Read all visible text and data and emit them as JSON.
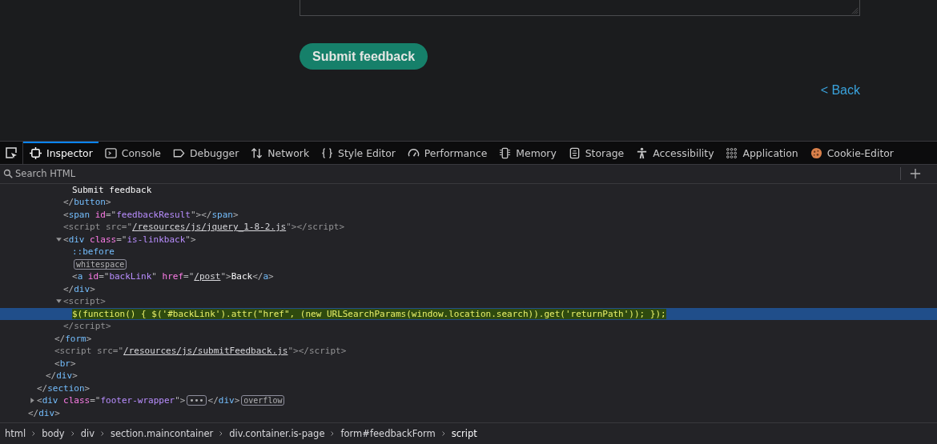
{
  "page": {
    "submit_button": "Submit feedback",
    "back_link": "< Back"
  },
  "toolbar": {
    "tabs": [
      {
        "label": "Inspector",
        "selected": true
      },
      {
        "label": "Console",
        "selected": false
      },
      {
        "label": "Debugger",
        "selected": false
      },
      {
        "label": "Network",
        "selected": false
      },
      {
        "label": "Style Editor",
        "selected": false
      },
      {
        "label": "Performance",
        "selected": false
      },
      {
        "label": "Memory",
        "selected": false
      },
      {
        "label": "Storage",
        "selected": false
      },
      {
        "label": "Accessibility",
        "selected": false
      },
      {
        "label": "Application",
        "selected": false
      },
      {
        "label": "Cookie-Editor",
        "selected": false
      }
    ]
  },
  "search": {
    "placeholder": "Search HTML"
  },
  "tree": [
    {
      "children": [
        {
          "children": [
            {
              "children": [
                {
                  "children": [
                    {
                      "children": [
                        {
                          "selected": false,
                          "tokens": [
                            {
                              "kind": "text",
                              "text": "Submit feedback"
                            }
                          ]
                        }
                      ]
                    },
                    {
                      "selected": false,
                      "tokens": [
                        {
                          "kind": "punct",
                          "text": "</"
                        },
                        {
                          "kind": "tag",
                          "text": "button"
                        },
                        {
                          "kind": "punct",
                          "text": ">"
                        }
                      ]
                    },
                    {
                      "selected": false,
                      "tokens": [
                        {
                          "kind": "punct",
                          "text": "<"
                        },
                        {
                          "kind": "tag",
                          "text": "span"
                        },
                        {
                          "kind": "attr",
                          "text": " id"
                        },
                        {
                          "kind": "punct",
                          "text": "=\""
                        },
                        {
                          "kind": "value",
                          "text": "feedbackResult"
                        },
                        {
                          "kind": "punct",
                          "text": "\"></"
                        },
                        {
                          "kind": "tag",
                          "text": "span"
                        },
                        {
                          "kind": "punct",
                          "text": ">"
                        }
                      ]
                    },
                    {
                      "selected": false,
                      "tokens": [
                        {
                          "kind": "dim",
                          "text": "<script src=\""
                        },
                        {
                          "kind": "link",
                          "text": "/resources/js/jquery_1-8-2.js"
                        },
                        {
                          "kind": "dim",
                          "text": "\"></script>"
                        }
                      ]
                    },
                    {
                      "selected": false,
                      "expanded": true,
                      "tokens": [
                        {
                          "kind": "punct",
                          "text": "<"
                        },
                        {
                          "kind": "tag",
                          "text": "div"
                        },
                        {
                          "kind": "attr",
                          "text": " class"
                        },
                        {
                          "kind": "punct",
                          "text": "=\""
                        },
                        {
                          "kind": "value",
                          "text": "is-linkback"
                        },
                        {
                          "kind": "punct",
                          "text": "\">"
                        }
                      ],
                      "children": [
                        {
                          "selected": false,
                          "tokens": [
                            {
                              "kind": "tag",
                              "text": "::before"
                            }
                          ]
                        },
                        {
                          "selected": false,
                          "tokens": [
                            {
                              "kind": "badge",
                              "text": "whitespace"
                            }
                          ]
                        },
                        {
                          "selected": false,
                          "tokens": [
                            {
                              "kind": "punct",
                              "text": "<"
                            },
                            {
                              "kind": "tag",
                              "text": "a"
                            },
                            {
                              "kind": "attr",
                              "text": " id"
                            },
                            {
                              "kind": "punct",
                              "text": "=\""
                            },
                            {
                              "kind": "value",
                              "text": "backLink"
                            },
                            {
                              "kind": "punct",
                              "text": "\" "
                            },
                            {
                              "kind": "attr",
                              "text": "href"
                            },
                            {
                              "kind": "punct",
                              "text": "=\""
                            },
                            {
                              "kind": "link",
                              "text": "/post"
                            },
                            {
                              "kind": "punct",
                              "text": "\">"
                            },
                            {
                              "kind": "text",
                              "text": "Back"
                            },
                            {
                              "kind": "punct",
                              "text": "</"
                            },
                            {
                              "kind": "tag",
                              "text": "a"
                            },
                            {
                              "kind": "punct",
                              "text": ">"
                            }
                          ]
                        }
                      ]
                    },
                    {
                      "selected": false,
                      "tokens": [
                        {
                          "kind": "punct",
                          "text": "</"
                        },
                        {
                          "kind": "tag",
                          "text": "div"
                        },
                        {
                          "kind": "punct",
                          "text": ">"
                        }
                      ]
                    },
                    {
                      "selected": false,
                      "expanded": true,
                      "tokens": [
                        {
                          "kind": "dim",
                          "text": "<script>"
                        }
                      ],
                      "children": [
                        {
                          "selected": true,
                          "tokens": [
                            {
                              "kind": "code",
                              "text": "$(function() { $('#backLink').attr(\"href\", (new URLSearchParams(window.location.search)).get('returnPath')); });"
                            }
                          ]
                        }
                      ]
                    },
                    {
                      "selected": false,
                      "tokens": [
                        {
                          "kind": "dim",
                          "text": "</script>"
                        }
                      ]
                    }
                  ]
                },
                {
                  "selected": false,
                  "tokens": [
                    {
                      "kind": "punct",
                      "text": "</"
                    },
                    {
                      "kind": "tag",
                      "text": "form"
                    },
                    {
                      "kind": "punct",
                      "text": ">"
                    }
                  ]
                },
                {
                  "selected": false,
                  "tokens": [
                    {
                      "kind": "dim",
                      "text": "<script src=\""
                    },
                    {
                      "kind": "link",
                      "text": "/resources/js/submitFeedback.js"
                    },
                    {
                      "kind": "dim",
                      "text": "\"></script>"
                    }
                  ]
                },
                {
                  "selected": false,
                  "tokens": [
                    {
                      "kind": "punct",
                      "text": "<"
                    },
                    {
                      "kind": "tag",
                      "text": "br"
                    },
                    {
                      "kind": "punct",
                      "text": ">"
                    }
                  ]
                }
              ]
            },
            {
              "selected": false,
              "tokens": [
                {
                  "kind": "punct",
                  "text": "</"
                },
                {
                  "kind": "tag",
                  "text": "div"
                },
                {
                  "kind": "punct",
                  "text": ">"
                }
              ]
            }
          ]
        },
        {
          "selected": false,
          "tokens": [
            {
              "kind": "punct",
              "text": "</"
            },
            {
              "kind": "tag",
              "text": "section"
            },
            {
              "kind": "punct",
              "text": ">"
            }
          ]
        },
        {
          "selected": false,
          "expanded": false,
          "tokens": [
            {
              "kind": "punct",
              "text": "<"
            },
            {
              "kind": "tag",
              "text": "div"
            },
            {
              "kind": "attr",
              "text": " class"
            },
            {
              "kind": "punct",
              "text": "=\""
            },
            {
              "kind": "value",
              "text": "footer-wrapper"
            },
            {
              "kind": "punct",
              "text": "\">"
            },
            {
              "kind": "badge",
              "text": "•••"
            },
            {
              "kind": "punct",
              "text": "</"
            },
            {
              "kind": "tag",
              "text": "div"
            },
            {
              "kind": "punct",
              "text": ">"
            },
            {
              "kind": "badge",
              "text": "overflow"
            }
          ]
        }
      ]
    },
    {
      "selected": false,
      "tokens": [
        {
          "kind": "punct",
          "text": "</"
        },
        {
          "kind": "tag",
          "text": "div"
        },
        {
          "kind": "punct",
          "text": ">"
        }
      ]
    }
  ],
  "breadcrumbs": [
    {
      "label": "html",
      "selected": false
    },
    {
      "label": "body",
      "selected": false
    },
    {
      "label": "div",
      "selected": false
    },
    {
      "label": "section.maincontainer",
      "selected": false
    },
    {
      "label": "div.container.is-page",
      "selected": false
    },
    {
      "label": "form#feedbackForm",
      "selected": false
    },
    {
      "label": "script",
      "selected": true
    }
  ]
}
